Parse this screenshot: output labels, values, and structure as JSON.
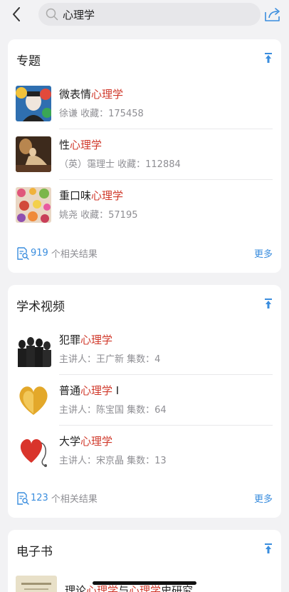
{
  "search": {
    "query": "心理学"
  },
  "sections": [
    {
      "title": "专题",
      "items": [
        {
          "name_pre": "微表情",
          "name_hl": "心理学",
          "name_post": "",
          "meta": "徐谦 收藏：175458"
        },
        {
          "name_pre": "性",
          "name_hl": "心理学",
          "name_post": "",
          "meta": "（英）霭理士 收藏：112884"
        },
        {
          "name_pre": "重口味",
          "name_hl": "心理学",
          "name_post": "",
          "meta": "姚尧 收藏：57195"
        }
      ],
      "count": "919",
      "count_suffix": "个相关结果",
      "more": "更多"
    },
    {
      "title": "学术视频",
      "items": [
        {
          "name_pre": "犯罪",
          "name_hl": "心理学",
          "name_post": "",
          "meta": "主讲人：王广新   集数：4"
        },
        {
          "name_pre": "普通",
          "name_hl": "心理学",
          "name_post": " I",
          "meta": "主讲人：陈宝国   集数：64"
        },
        {
          "name_pre": "大学",
          "name_hl": "心理学",
          "name_post": "",
          "meta": "主讲人：宋京晶   集数：13"
        }
      ],
      "count": "123",
      "count_suffix": "个相关结果",
      "more": "更多"
    },
    {
      "title": "电子书",
      "items": [
        {
          "name_pre": "理论",
          "name_hl": "心理学",
          "name_mid": "与",
          "name_hl2": "心理学",
          "name_post": "史研究"
        }
      ]
    }
  ],
  "colors": {
    "highlight": "#d0392b",
    "accent": "#3a8dde"
  }
}
